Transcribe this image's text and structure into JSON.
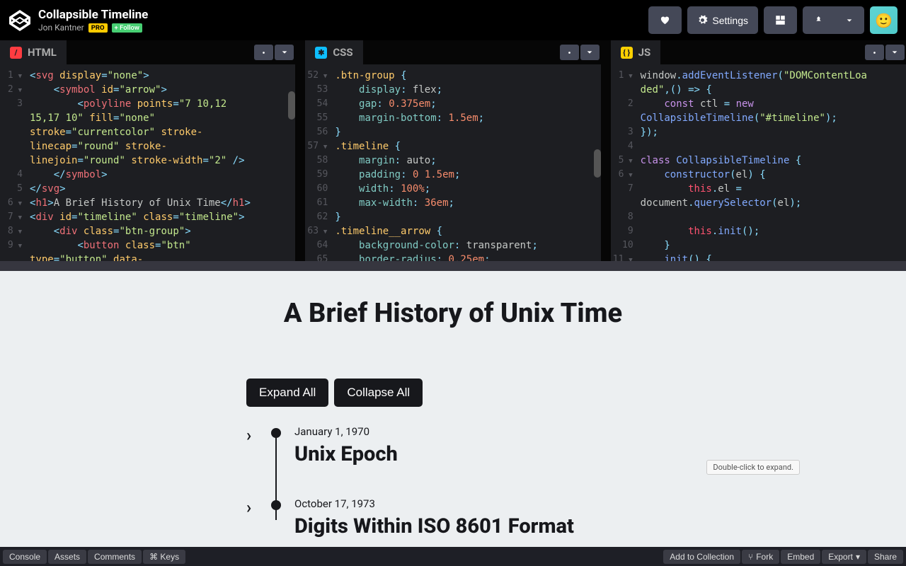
{
  "header": {
    "title": "Collapsible Timeline",
    "author": "Jon Kantner",
    "pro": "PRO",
    "follow": "+ Follow",
    "settings": "Settings"
  },
  "editors": {
    "html": {
      "label": "HTML"
    },
    "css": {
      "label": "CSS"
    },
    "js": {
      "label": "JS"
    }
  },
  "html_lines": [
    {
      "n": "1",
      "fold": true,
      "html": "<span class='tok-punc'>&lt;</span><span class='tok-tag'>svg</span> <span class='tok-attr'>display</span><span class='tok-punc'>=</span><span class='tok-str'>\"none\"</span><span class='tok-punc'>&gt;</span>"
    },
    {
      "n": "2",
      "fold": true,
      "html": "    <span class='tok-punc'>&lt;</span><span class='tok-tag'>symbol</span> <span class='tok-attr'>id</span><span class='tok-punc'>=</span><span class='tok-str'>\"arrow\"</span><span class='tok-punc'>&gt;</span>"
    },
    {
      "n": "3",
      "html": "        <span class='tok-punc'>&lt;</span><span class='tok-tag'>polyline</span> <span class='tok-attr'>points</span><span class='tok-punc'>=</span><span class='tok-str'>\"7 10,12 </span>"
    },
    {
      "n": "",
      "html": "<span class='tok-str'>15,17 10\"</span> <span class='tok-attr'>fill</span><span class='tok-punc'>=</span><span class='tok-str'>\"none\"</span> "
    },
    {
      "n": "",
      "html": "<span class='tok-attr'>stroke</span><span class='tok-punc'>=</span><span class='tok-str'>\"currentcolor\"</span> <span class='tok-attr'>stroke-</span>"
    },
    {
      "n": "",
      "html": "<span class='tok-attr'>linecap</span><span class='tok-punc'>=</span><span class='tok-str'>\"round\"</span> <span class='tok-attr'>stroke-</span>"
    },
    {
      "n": "",
      "html": "<span class='tok-attr'>linejoin</span><span class='tok-punc'>=</span><span class='tok-str'>\"round\"</span> <span class='tok-attr'>stroke-width</span><span class='tok-punc'>=</span><span class='tok-str'>\"2\"</span> <span class='tok-punc'>/&gt;</span>"
    },
    {
      "n": "4",
      "html": "    <span class='tok-punc'>&lt;/</span><span class='tok-tag'>symbol</span><span class='tok-punc'>&gt;</span>"
    },
    {
      "n": "5",
      "html": "<span class='tok-punc'>&lt;/</span><span class='tok-tag'>svg</span><span class='tok-punc'>&gt;</span>"
    },
    {
      "n": "6",
      "fold": true,
      "html": "<span class='tok-punc'>&lt;</span><span class='tok-tag'>h1</span><span class='tok-punc'>&gt;</span>A Brief History of Unix Time<span class='tok-punc'>&lt;/</span><span class='tok-tag'>h1</span><span class='tok-punc'>&gt;</span>"
    },
    {
      "n": "7",
      "fold": true,
      "html": "<span class='tok-punc'>&lt;</span><span class='tok-tag'>div</span> <span class='tok-attr'>id</span><span class='tok-punc'>=</span><span class='tok-str'>\"timeline\"</span> <span class='tok-attr'>class</span><span class='tok-punc'>=</span><span class='tok-str'>\"timeline\"</span><span class='tok-punc'>&gt;</span>"
    },
    {
      "n": "8",
      "fold": true,
      "html": "    <span class='tok-punc'>&lt;</span><span class='tok-tag'>div</span> <span class='tok-attr'>class</span><span class='tok-punc'>=</span><span class='tok-str'>\"btn-group\"</span><span class='tok-punc'>&gt;</span>"
    },
    {
      "n": "9",
      "fold": true,
      "html": "        <span class='tok-punc'>&lt;</span><span class='tok-tag'>button</span> <span class='tok-attr'>class</span><span class='tok-punc'>=</span><span class='tok-str'>\"btn\"</span> "
    },
    {
      "n": "",
      "html": "<span class='tok-attr'>type</span><span class='tok-punc'>=</span><span class='tok-str'>\"button\"</span> <span class='tok-attr'>data-</span>"
    }
  ],
  "css_lines": [
    {
      "n": "52",
      "fold": true,
      "html": "<span class='tok-sel'>.btn-group</span> <span class='tok-punc'>{</span>"
    },
    {
      "n": "53",
      "html": "    <span class='tok-prop'>display</span><span class='tok-punc'>:</span> flex<span class='tok-punc'>;</span>"
    },
    {
      "n": "54",
      "html": "    <span class='tok-prop'>gap</span><span class='tok-punc'>:</span> <span class='tok-num'>0.375em</span><span class='tok-punc'>;</span>"
    },
    {
      "n": "55",
      "html": "    <span class='tok-prop'>margin-bottom</span><span class='tok-punc'>:</span> <span class='tok-num'>1.5em</span><span class='tok-punc'>;</span>"
    },
    {
      "n": "56",
      "html": "<span class='tok-punc'>}</span>"
    },
    {
      "n": "57",
      "fold": true,
      "html": "<span class='tok-sel'>.timeline</span> <span class='tok-punc'>{</span>"
    },
    {
      "n": "58",
      "html": "    <span class='tok-prop'>margin</span><span class='tok-punc'>:</span> auto<span class='tok-punc'>;</span>"
    },
    {
      "n": "59",
      "html": "    <span class='tok-prop'>padding</span><span class='tok-punc'>:</span> <span class='tok-num'>0</span> <span class='tok-num'>1.5em</span><span class='tok-punc'>;</span>"
    },
    {
      "n": "60",
      "html": "    <span class='tok-prop'>width</span><span class='tok-punc'>:</span> <span class='tok-num'>100%</span><span class='tok-punc'>;</span>"
    },
    {
      "n": "61",
      "html": "    <span class='tok-prop'>max-width</span><span class='tok-punc'>:</span> <span class='tok-num'>36em</span><span class='tok-punc'>;</span>"
    },
    {
      "n": "62",
      "html": "<span class='tok-punc'>}</span>"
    },
    {
      "n": "63",
      "fold": true,
      "html": "<span class='tok-sel'>.timeline__arrow</span> <span class='tok-punc'>{</span>"
    },
    {
      "n": "64",
      "html": "    <span class='tok-prop'>background-color</span><span class='tok-punc'>:</span> transparent<span class='tok-punc'>;</span>"
    },
    {
      "n": "65",
      "html": "    <span class='tok-prop'>border-radius</span><span class='tok-punc'>:</span> <span class='tok-num'>0.25em</span><span class='tok-punc'>;</span>"
    }
  ],
  "js_lines": [
    {
      "n": "1",
      "fold": true,
      "html": "window<span class='tok-punc'>.</span><span class='tok-func'>addEventListener</span><span class='tok-punc'>(</span><span class='tok-str'>\"DOMContentLoa</span>"
    },
    {
      "n": "",
      "html": "<span class='tok-str'>ded\"</span><span class='tok-punc'>,() =&gt; {</span>"
    },
    {
      "n": "2",
      "html": "    <span class='tok-key'>const</span> ctl <span class='tok-op'>=</span> <span class='tok-key'>new</span> "
    },
    {
      "n": "",
      "html": "<span class='tok-func'>CollapsibleTimeline</span><span class='tok-punc'>(</span><span class='tok-str'>\"#timeline\"</span><span class='tok-punc'>);</span>"
    },
    {
      "n": "3",
      "html": "<span class='tok-punc'>});</span>"
    },
    {
      "n": "4",
      "html": ""
    },
    {
      "n": "5",
      "fold": true,
      "html": "<span class='tok-key'>class</span> <span class='tok-func'>CollapsibleTimeline</span> <span class='tok-punc'>{</span>"
    },
    {
      "n": "6",
      "fold": true,
      "html": "    <span class='tok-func'>constructor</span><span class='tok-punc'>(</span>el<span class='tok-punc'>) {</span>"
    },
    {
      "n": "7",
      "html": "        <span class='tok-this'>this</span><span class='tok-punc'>.</span>el <span class='tok-op'>=</span> "
    },
    {
      "n": "",
      "html": "document<span class='tok-punc'>.</span><span class='tok-func'>querySelector</span><span class='tok-punc'>(</span>el<span class='tok-punc'>);</span>"
    },
    {
      "n": "8",
      "html": ""
    },
    {
      "n": "9",
      "html": "        <span class='tok-this'>this</span><span class='tok-punc'>.</span><span class='tok-func'>init</span><span class='tok-punc'>();</span>"
    },
    {
      "n": "10",
      "html": "    <span class='tok-punc'>}</span>"
    },
    {
      "n": "11",
      "fold": true,
      "html": "    <span class='tok-func'>init</span><span class='tok-punc'>() {</span>"
    }
  ],
  "preview": {
    "heading": "A Brief History of Unix Time",
    "expand": "Expand All",
    "collapse": "Collapse All",
    "items": [
      {
        "date": "January 1, 1970",
        "title": "Unix Epoch"
      },
      {
        "date": "October 17, 1973",
        "title": "Digits Within ISO 8601 Format"
      }
    ],
    "tooltip": "Double-click to expand."
  },
  "footer": {
    "console": "Console",
    "assets": "Assets",
    "comments": "Comments",
    "keys": "⌘ Keys",
    "add": "Add to Collection",
    "fork": "Fork",
    "embed": "Embed",
    "export": "Export",
    "share": "Share"
  }
}
